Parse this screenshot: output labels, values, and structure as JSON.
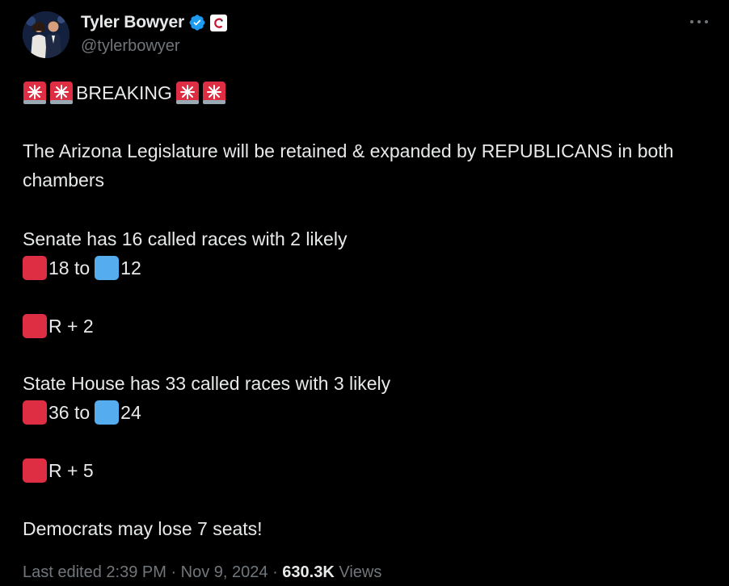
{
  "author": {
    "display_name": "Tyler Bowyer",
    "handle": "@tylerbowyer",
    "verified_icon": "verified-badge-icon",
    "affiliation_icon": "organization-logo-icon"
  },
  "tweet": {
    "headline_text": "BREAKING",
    "paragraph_1": "The Arizona Legislature will be retained & expanded by REPUBLICANS in both chambers",
    "senate_line": "Senate has 16 called races with 2 likely",
    "senate_red": "18 to",
    "senate_blue": "12",
    "senate_net": "R + 2",
    "house_line": "State House has 33 called races with 3 likely",
    "house_red": "36 to",
    "house_blue": "24",
    "house_net": "R + 5",
    "closing": "Democrats may lose 7 seats!"
  },
  "meta": {
    "last_edited": "Last edited 2:39 PM · Nov 9, 2024 · ",
    "views_count": "630.3K",
    "views_label": " Views"
  },
  "colors": {
    "background": "#000000",
    "text": "#e7e9ea",
    "muted": "#71767b",
    "verified": "#1d9bf0",
    "republican_red": "#dd2e44",
    "democrat_blue": "#55acee"
  }
}
